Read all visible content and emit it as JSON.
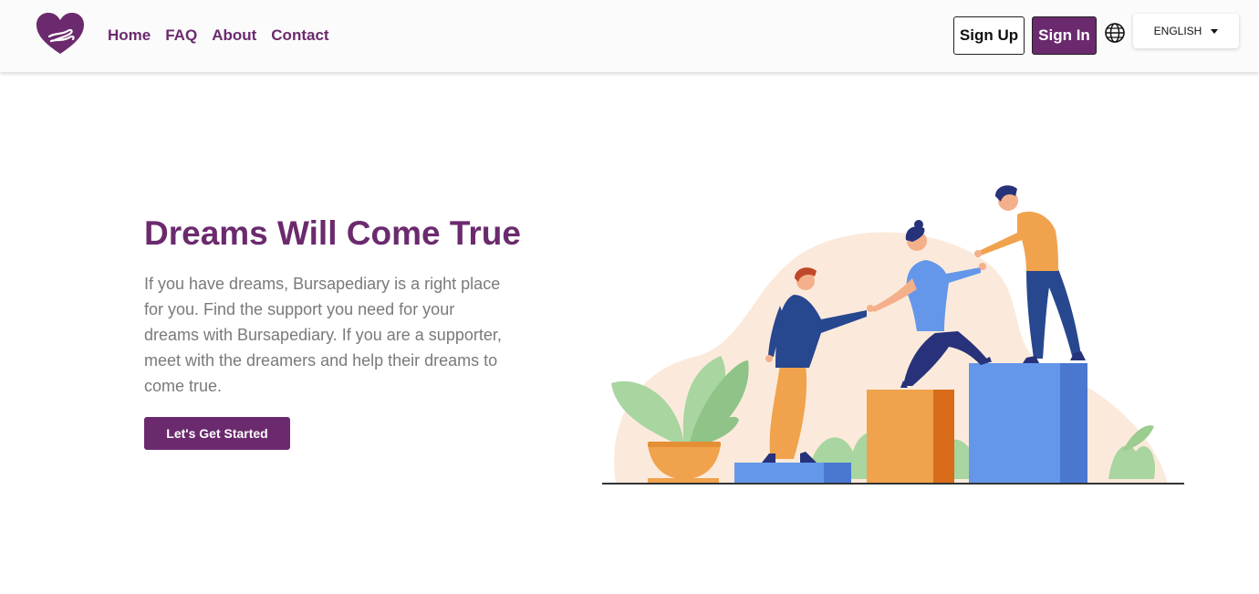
{
  "nav": {
    "links": [
      "Home",
      "FAQ",
      "About",
      "Contact"
    ],
    "signup_label": "Sign Up",
    "signin_label": "Sign In",
    "language": "ENGLISH"
  },
  "hero": {
    "title": "Dreams Will Come True",
    "text": "If you have dreams, Bursapediary is a right place for you. Find the support you need for your dreams with Bursapediary. If you are a supporter, meet with the dreamers and help their dreams to come true.",
    "cta_label": "Let's Get Started"
  },
  "colors": {
    "brand": "#6b2a6e",
    "text_muted": "#7a7a7a",
    "bar_orange": "#f0a24d",
    "bar_blue": "#6497ea"
  },
  "icons": {
    "logo": "heart-hands-logo",
    "globe": "globe-icon",
    "dropdown": "caret-down-icon"
  }
}
